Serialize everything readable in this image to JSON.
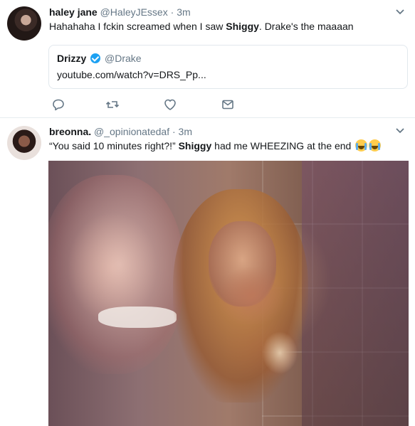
{
  "tweets": [
    {
      "author": {
        "name": "haley jane",
        "handle": "@HaleyJEssex",
        "time": "3m",
        "avatar_icon": "profile-photo"
      },
      "text_before": "Hahahaha I f",
      "text_obscured": "",
      "text_middle": "ckin screamed when I saw ",
      "text_bold": "Shiggy",
      "text_after": ". Drake's the maaaan",
      "quoted_card": {
        "name": "Drizzy",
        "handle": "@Drake",
        "url": "youtube.com/watch?v=DRS_Pp..."
      },
      "actions": [
        "reply-icon",
        "retweet-icon",
        "like-icon",
        "direct-message-icon"
      ]
    },
    {
      "author": {
        "name": "breonna.",
        "handle": "@_opinionatedaf",
        "time": "3m",
        "avatar_icon": "profile-photo"
      },
      "text_before": "“You said 10 minutes right?!” ",
      "text_bold": "Shiggy",
      "text_after": " had me WHEEZING at the end",
      "emoji": [
        "loudly-crying-face-emoji",
        "loudly-crying-face-emoji"
      ],
      "media": "photo-woman-laughing"
    }
  ],
  "separator": " · ",
  "colors": {
    "text": "#14171a",
    "secondary": "#657786",
    "verified": "#1da1f2",
    "border": "#e1e8ed"
  }
}
